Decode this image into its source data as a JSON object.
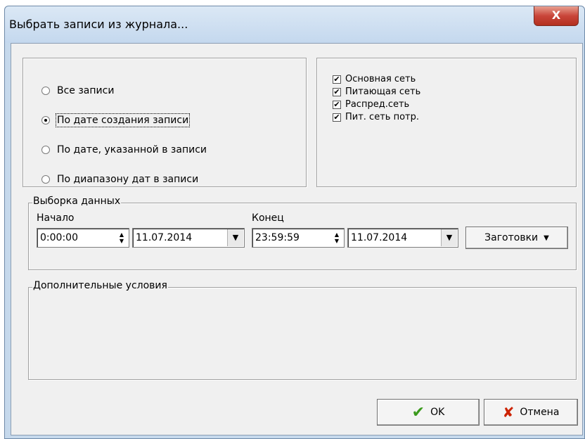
{
  "window": {
    "title": "Выбрать записи из журнала...",
    "close_label": "X"
  },
  "record_filter": {
    "options": [
      {
        "label": "Все записи",
        "selected": false
      },
      {
        "label": "По дате создания записи",
        "selected": true
      },
      {
        "label": "По дате, указанной в записи",
        "selected": false
      },
      {
        "label": "По диапазону дат в записи",
        "selected": false
      }
    ]
  },
  "networks": {
    "items": [
      {
        "label": "Основная сеть",
        "checked": true
      },
      {
        "label": "Питающая сеть",
        "checked": true
      },
      {
        "label": "Распред.сеть",
        "checked": true
      },
      {
        "label": "Пит. сеть потр.",
        "checked": true
      }
    ]
  },
  "data_selection": {
    "group_label": "Выборка данных",
    "start": {
      "label": "Начало",
      "time": "0:00:00",
      "date": "11.07.2014"
    },
    "end": {
      "label": "Конец",
      "time": "23:59:59",
      "date": "11.07.2014"
    },
    "presets_label": "Заготовки"
  },
  "extra_conditions": {
    "group_label": "Дополнительные условия"
  },
  "buttons": {
    "ok_label": "OK",
    "cancel_label": "Отмена"
  },
  "colors": {
    "ok_icon": "#3a9a1c",
    "cancel_icon": "#cc2200",
    "close_button": "#c9453a"
  }
}
